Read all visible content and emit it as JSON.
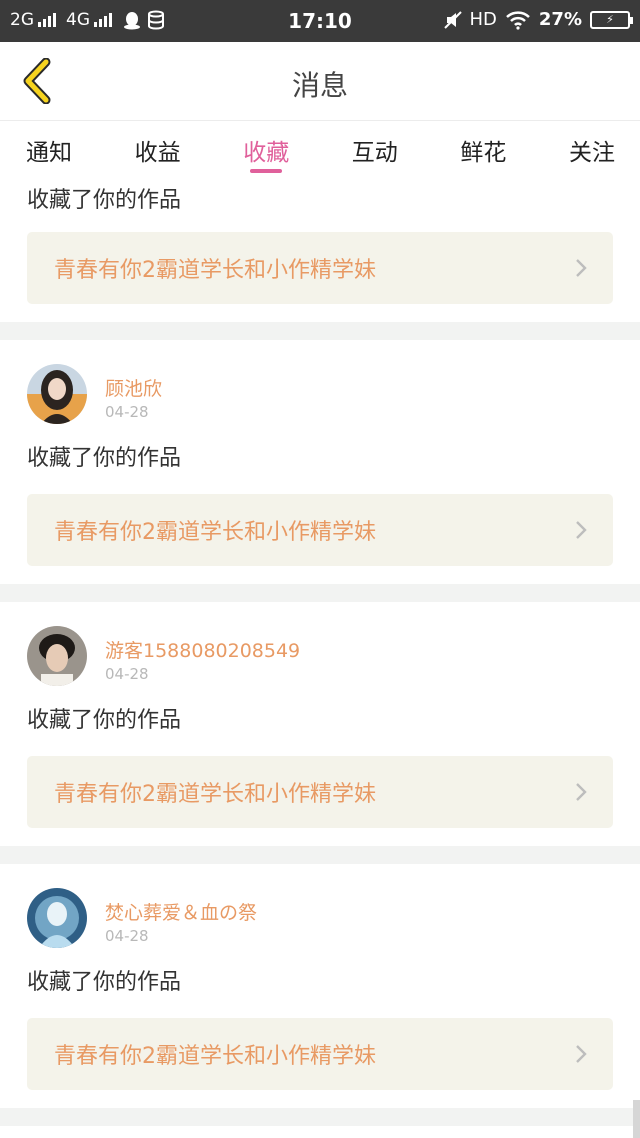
{
  "status_bar": {
    "network_1": "2G",
    "network_2": "4G",
    "time": "17:10",
    "hd": "HD",
    "battery": "27%",
    "icons": [
      "signal-icon",
      "qq-icon",
      "database-icon",
      "mute-icon",
      "wifi-icon",
      "battery-charging-icon"
    ]
  },
  "header": {
    "title": "消息",
    "back_icon": "chevron-left-icon",
    "accent": "#f6d31f"
  },
  "tabs": [
    {
      "label": "通知",
      "active": false
    },
    {
      "label": "收益",
      "active": false
    },
    {
      "label": "收藏",
      "active": true
    },
    {
      "label": "互动",
      "active": false
    },
    {
      "label": "鲜花",
      "active": false
    },
    {
      "label": "关注",
      "active": false
    }
  ],
  "colors": {
    "active_tab": "#e0609b",
    "username": "#e89a64",
    "work_title": "#e89a64",
    "work_box_bg": "#f4f3ea",
    "date": "#b8b8b8"
  },
  "partial_item": {
    "action": "收藏了你的作品",
    "work_title": "青春有你2霸道学长和小作精学妹"
  },
  "items": [
    {
      "user": "顾池欣",
      "date": "04-28",
      "action": "收藏了你的作品",
      "work_title": "青春有你2霸道学长和小作精学妹"
    },
    {
      "user": "游客1588080208549",
      "date": "04-28",
      "action": "收藏了你的作品",
      "work_title": "青春有你2霸道学长和小作精学妹"
    },
    {
      "user": "焚心葬爱＆血の祭",
      "date": "04-28",
      "action": "收藏了你的作品",
      "work_title": "青春有你2霸道学长和小作精学妹"
    }
  ]
}
